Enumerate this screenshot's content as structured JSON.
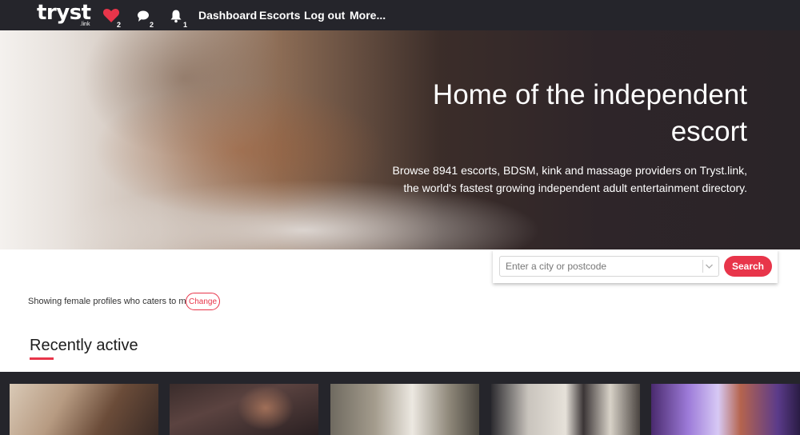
{
  "nav": {
    "logo": "tryst",
    "logo_sub": ".link",
    "favorites_count": "2",
    "messages_count": "2",
    "notifications_count": "1",
    "links": [
      "Dashboard",
      "Escorts",
      "Log out",
      "More..."
    ]
  },
  "hero": {
    "title": "Home of the independent escort",
    "subtitle_line1": "Browse 8941 escorts, BDSM, kink and massage providers on Tryst.link,",
    "subtitle_line2": "the world's fastest growing independent adult entertainment directory."
  },
  "search": {
    "placeholder": "Enter a city or postcode",
    "button": "Search"
  },
  "filter": {
    "text": "Showing female profiles who caters to male.",
    "change": "Change"
  },
  "section": {
    "title": "Recently active"
  },
  "colors": {
    "accent": "#e8354a",
    "nav_bg": "#25252b"
  },
  "icons": [
    "heart-icon",
    "chat-bubble-icon",
    "bell-icon",
    "chevron-down-icon"
  ]
}
